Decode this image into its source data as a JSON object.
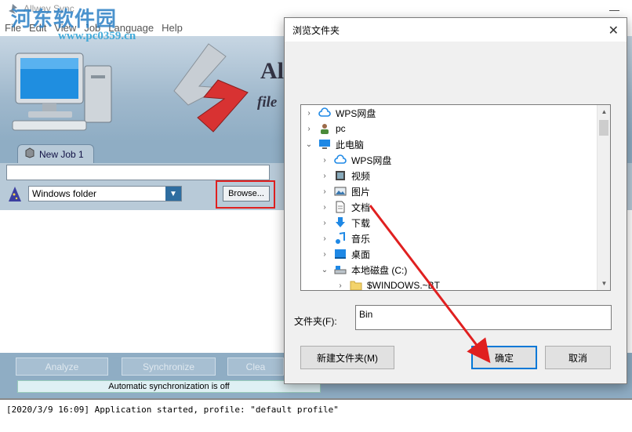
{
  "app": {
    "title": "Allway Sync",
    "menu": [
      "File",
      "Edit",
      "View",
      "Job",
      "Language",
      "Help"
    ],
    "watermark_cn": "河东软件园",
    "watermark_url": "www.pc0359.cn",
    "brand_text": "Al",
    "brand_sub": "file",
    "tab_label": "New Job 1",
    "path_value": "",
    "folder_type": "Windows folder",
    "browse_label": "Browse...",
    "buttons": {
      "analyze": "Analyze",
      "synchronize": "Synchronize",
      "clean": "Clea"
    },
    "status": "Automatic synchronization is off",
    "log": "[2020/3/9 16:09] Application started, profile: \"default profile\""
  },
  "dialog": {
    "title": "浏览文件夹",
    "tree": [
      {
        "label": "WPS网盘",
        "icon": "cloud-icon",
        "level": 0,
        "expander": "collapsed"
      },
      {
        "label": "pc",
        "icon": "user-icon",
        "level": 0,
        "expander": "collapsed"
      },
      {
        "label": "此电脑",
        "icon": "computer-icon",
        "level": 0,
        "expander": "expanded"
      },
      {
        "label": "WPS网盘",
        "icon": "cloud-icon",
        "level": 1,
        "expander": "collapsed"
      },
      {
        "label": "视频",
        "icon": "video-icon",
        "level": 1,
        "expander": "collapsed"
      },
      {
        "label": "图片",
        "icon": "picture-icon",
        "level": 1,
        "expander": "collapsed"
      },
      {
        "label": "文档",
        "icon": "document-icon",
        "level": 1,
        "expander": "collapsed"
      },
      {
        "label": "下载",
        "icon": "download-icon",
        "level": 1,
        "expander": "collapsed"
      },
      {
        "label": "音乐",
        "icon": "music-icon",
        "level": 1,
        "expander": "collapsed"
      },
      {
        "label": "桌面",
        "icon": "desktop-icon",
        "level": 1,
        "expander": "collapsed"
      },
      {
        "label": "本地磁盘 (C:)",
        "icon": "drive-icon",
        "level": 1,
        "expander": "expanded"
      },
      {
        "label": "$WINDOWS.~BT",
        "icon": "folder-icon",
        "level": 2,
        "expander": "collapsed"
      }
    ],
    "folder_label": "文件夹(F):",
    "folder_value": "Bin",
    "new_folder": "新建文件夹(M)",
    "ok": "确定",
    "cancel": "取消"
  },
  "colors": {
    "highlight": "#e02020",
    "accent": "#0078d7",
    "banner": "#9fb8cc"
  }
}
